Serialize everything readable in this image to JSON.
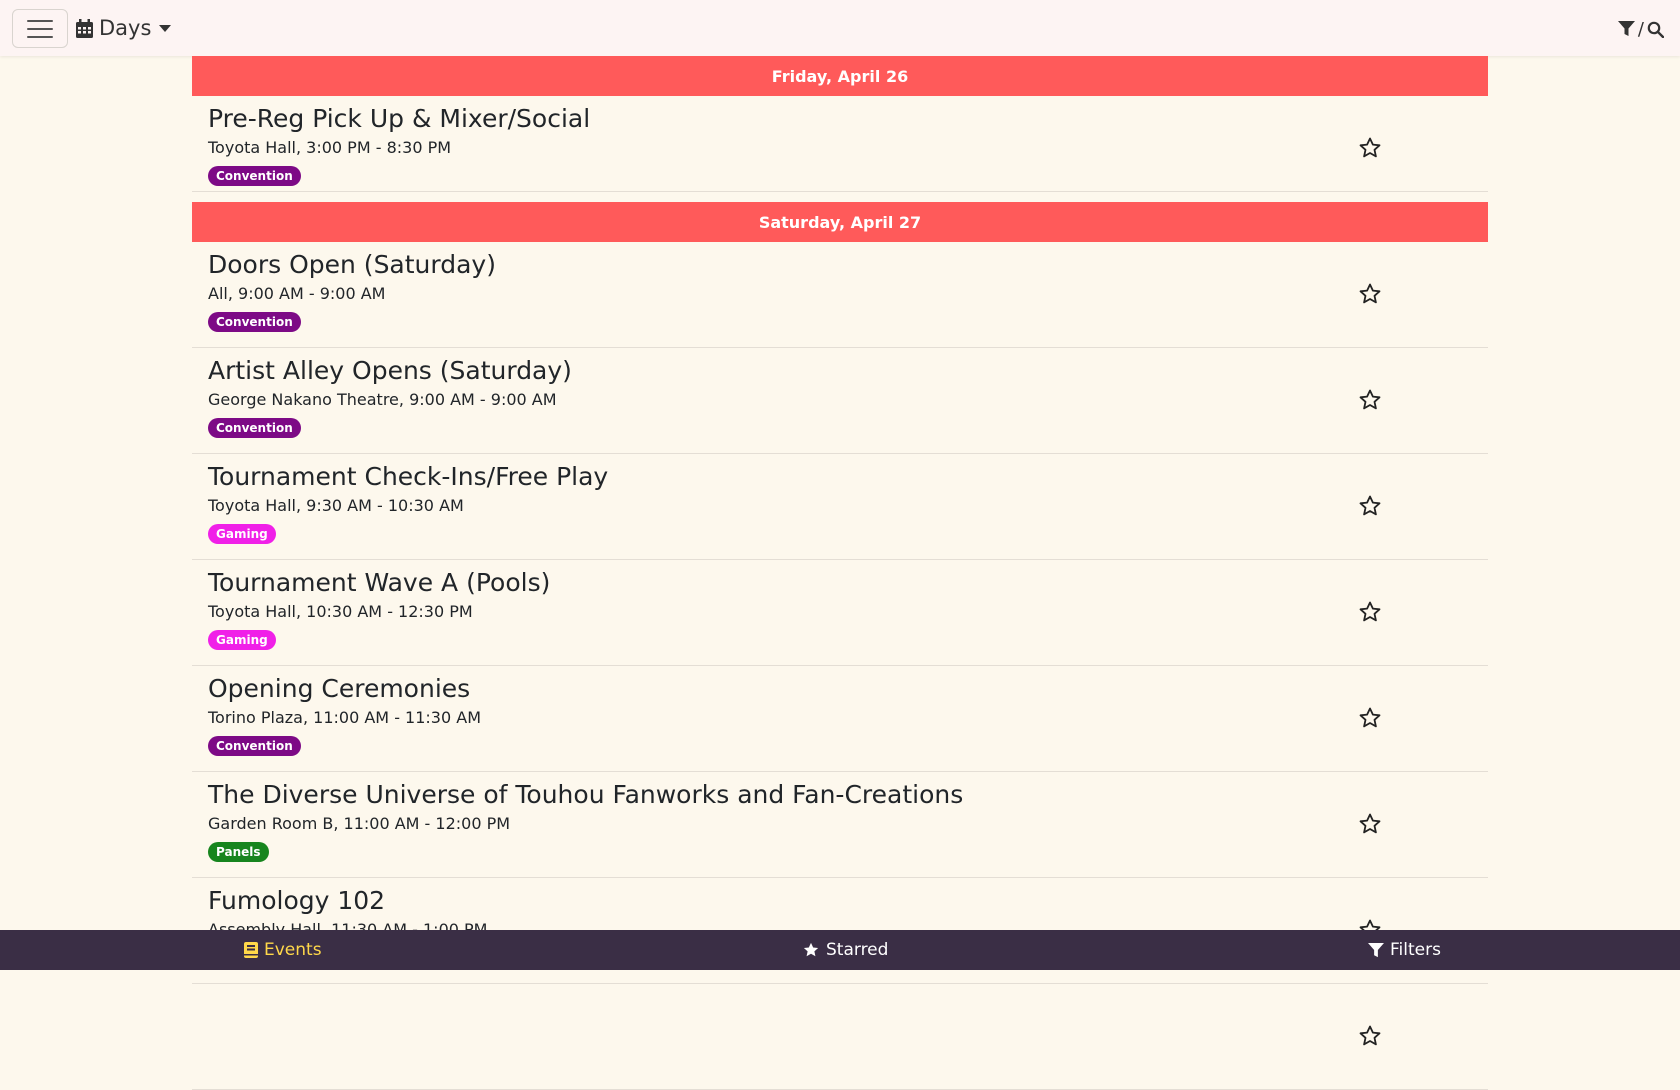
{
  "header": {
    "days_label": "Days",
    "search_separator": "/"
  },
  "days": [
    {
      "label": "Friday, April 26",
      "events": [
        {
          "title": "Pre-Reg Pick Up & Mixer/Social",
          "meta": "Toyota Hall, 3:00 PM - 8:30 PM",
          "category": "Convention",
          "color": "#7d0a86"
        }
      ]
    },
    {
      "label": "Saturday, April 27",
      "events": [
        {
          "title": "Doors Open (Saturday)",
          "meta": "All, 9:00 AM - 9:00 AM",
          "category": "Convention",
          "color": "#7d0a86"
        },
        {
          "title": "Artist Alley Opens (Saturday)",
          "meta": "George Nakano Theatre, 9:00 AM - 9:00 AM",
          "category": "Convention",
          "color": "#7d0a86"
        },
        {
          "title": "Tournament Check-Ins/Free Play",
          "meta": "Toyota Hall, 9:30 AM - 10:30 AM",
          "category": "Gaming",
          "color": "#f020e8"
        },
        {
          "title": "Tournament Wave A (Pools)",
          "meta": "Toyota Hall, 10:30 AM - 12:30 PM",
          "category": "Gaming",
          "color": "#f020e8"
        },
        {
          "title": "Opening Ceremonies",
          "meta": "Torino Plaza, 11:00 AM - 11:30 AM",
          "category": "Convention",
          "color": "#7d0a86"
        },
        {
          "title": "The Diverse Universe of Touhou Fanworks and Fan-Creations",
          "meta": "Garden Room B, 11:00 AM - 12:00 PM",
          "category": "Panels",
          "color": "#17851e"
        },
        {
          "title": "Fumology 102",
          "meta": "Assembly Hall, 11:30 AM - 1:00 PM",
          "category": "",
          "color": "#7d0a86"
        }
      ]
    }
  ],
  "bottom_nav": {
    "events_label": "Events",
    "starred_label": "Starred",
    "filters_label": "Filters",
    "active_color": "#ffd84a"
  }
}
